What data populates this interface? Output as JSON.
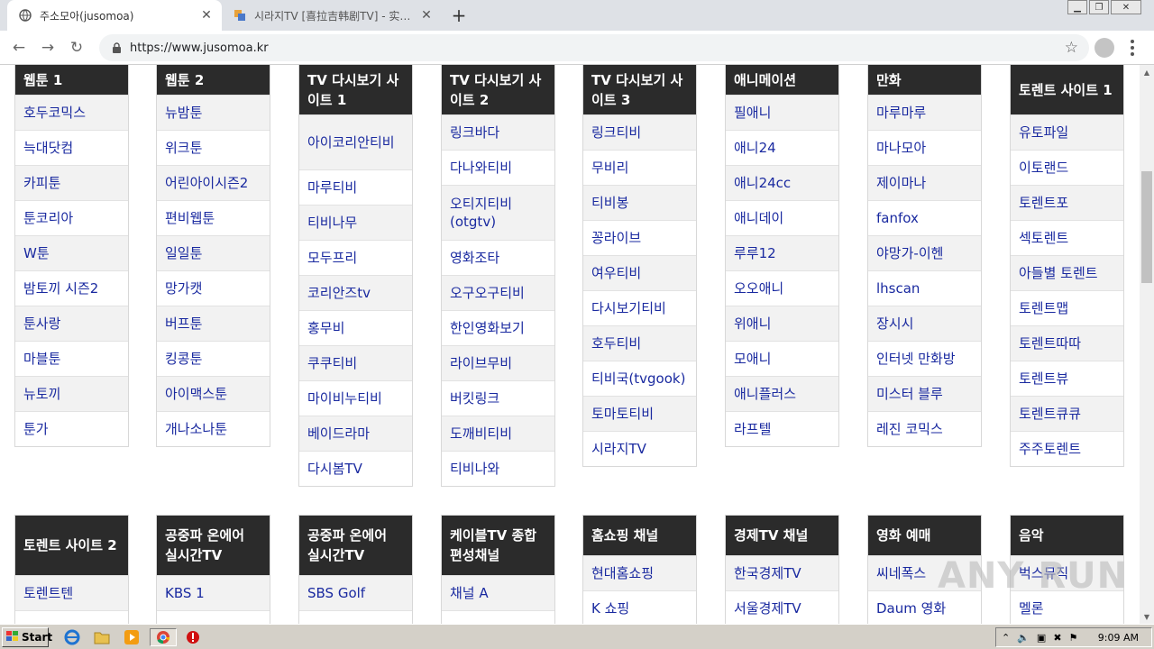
{
  "browser": {
    "tabs": [
      {
        "title": "주소모아(jusomoa)",
        "active": true
      },
      {
        "title": "시라지TV [喜拉吉韩剧TV] - 实时更新 ...",
        "active": false
      }
    ],
    "new_tab_label": "+",
    "url": "https://www.jusomoa.kr"
  },
  "sections_row1": [
    {
      "title": "웹툰 1",
      "items": [
        "호두코믹스",
        "늑대닷컴",
        "카피툰",
        "툰코리아",
        "W툰",
        "밤토끼 시즌2",
        "툰사랑",
        "마블툰",
        "뉴토끼",
        "툰가"
      ]
    },
    {
      "title": "웹툰 2",
      "items": [
        "뉴밤툰",
        "위크툰",
        "어린아이시즌2",
        "편비웹툰",
        "일일툰",
        "망가캣",
        "버프툰",
        "킹콩툰",
        "아이맥스툰",
        "개나소나툰"
      ]
    },
    {
      "title": "TV 다시보기 사이트 1",
      "items": [
        "아이코리안티비",
        "마루티비",
        "티비나무",
        "모두프리",
        "코리안즈tv",
        "홍무비",
        "쿠쿠티비",
        "마이비누티비",
        "베이드라마",
        "다시봄TV"
      ]
    },
    {
      "title": "TV 다시보기 사이트 2",
      "items": [
        "링크바다",
        "다나와티비",
        "오티지티비(otgtv)",
        "영화조타",
        "오구오구티비",
        "한인영화보기",
        "라이브무비",
        "버킷링크",
        "도깨비티비",
        "티비나와"
      ]
    },
    {
      "title": "TV 다시보기 사이트 3",
      "items": [
        "링크티비",
        "무비리",
        "티비봉",
        "꽁라이브",
        "여우티비",
        "다시보기티비",
        "호두티비",
        "티비국(tvgook)",
        "토마토티비",
        "시라지TV"
      ]
    },
    {
      "title": "애니메이션",
      "items": [
        "필애니",
        "애니24",
        "애니24cc",
        "애니데이",
        "루루12",
        "오오애니",
        "위애니",
        "모애니",
        "애니플러스",
        "라프텔"
      ]
    },
    {
      "title": "만화",
      "items": [
        "마루마루",
        "마나모아",
        "제이마나",
        "fanfox",
        "야망가-이헨",
        "lhscan",
        "장시시",
        "인터넷 만화방",
        "미스터 블루",
        "레진 코믹스"
      ]
    },
    {
      "title": "토렌트 사이트 1",
      "items": [
        "유토파일",
        "이토랜드",
        "토렌트포",
        "섹토렌트",
        "아들별 토렌트",
        "토렌트맵",
        "토렌트따따",
        "토렌트뷰",
        "토렌트큐큐",
        "주주토렌트"
      ]
    }
  ],
  "sections_row2": [
    {
      "title": "토렌트 사이트 2",
      "items": [
        "토렌트텐",
        ""
      ]
    },
    {
      "title": "공중파 온에어 실시간TV",
      "items": [
        "KBS 1",
        ""
      ]
    },
    {
      "title": "공중파 온에어 실시간TV",
      "items": [
        "SBS Golf",
        ""
      ]
    },
    {
      "title": "케이블TV 종합 편성채널",
      "items": [
        "채널 A",
        ""
      ]
    },
    {
      "title": "홈쇼핑 채널",
      "items": [
        "현대홈쇼핑",
        "K 쇼핑"
      ]
    },
    {
      "title": "경제TV 채널",
      "items": [
        "한국경제TV",
        "서울경제TV"
      ]
    },
    {
      "title": "영화 예매",
      "items": [
        "씨네폭스",
        "Daum 영화"
      ]
    },
    {
      "title": "음악",
      "items": [
        "벅스뮤직",
        "멜론"
      ]
    }
  ],
  "watermark": "ANY RUN",
  "taskbar": {
    "start_label": "Start",
    "clock": "9:09 AM"
  },
  "colors": {
    "header_bg": "#2b2b2b",
    "link": "#1a2aa0",
    "taskbar": "#d4d0c8"
  }
}
